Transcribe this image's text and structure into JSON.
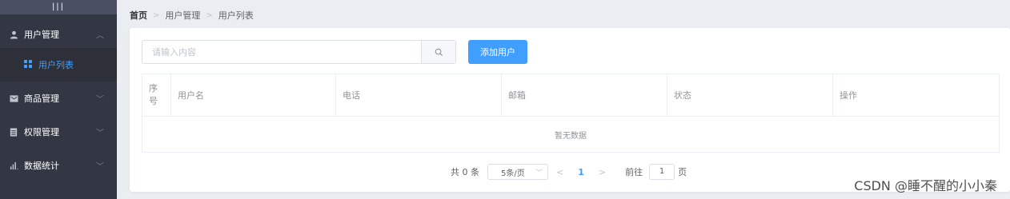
{
  "sidebar": {
    "toggle": "|||",
    "items": [
      {
        "label": "用户管理",
        "icon": "user-icon",
        "expanded": true
      },
      {
        "label": "商品管理",
        "icon": "box-icon",
        "expanded": false
      },
      {
        "label": "权限管理",
        "icon": "doc-icon",
        "expanded": false
      },
      {
        "label": "数据统计",
        "icon": "bar-chart-icon",
        "expanded": false
      }
    ],
    "submenu": {
      "label": "用户列表",
      "icon": "grid-icon"
    }
  },
  "breadcrumb": [
    "首页",
    "用户管理",
    "用户列表"
  ],
  "search": {
    "placeholder": "请输入内容",
    "value": ""
  },
  "add_button": "添加用户",
  "table": {
    "headers": [
      "序号",
      "用户名",
      "电话",
      "邮箱",
      "状态",
      "操作"
    ],
    "index_header_lines": [
      "序",
      "号"
    ],
    "empty_text": "暂无数据"
  },
  "pagination": {
    "total": "共 0 条",
    "page_size": "5条/页",
    "current_page": "1",
    "goto_label": "前往",
    "goto_value": "1",
    "page_suffix": "页"
  },
  "watermark": "CSDN @睡不醒的小小秦",
  "colors": {
    "sidebar": "#333744",
    "accent": "#409eff",
    "background": "#eaedf1"
  }
}
